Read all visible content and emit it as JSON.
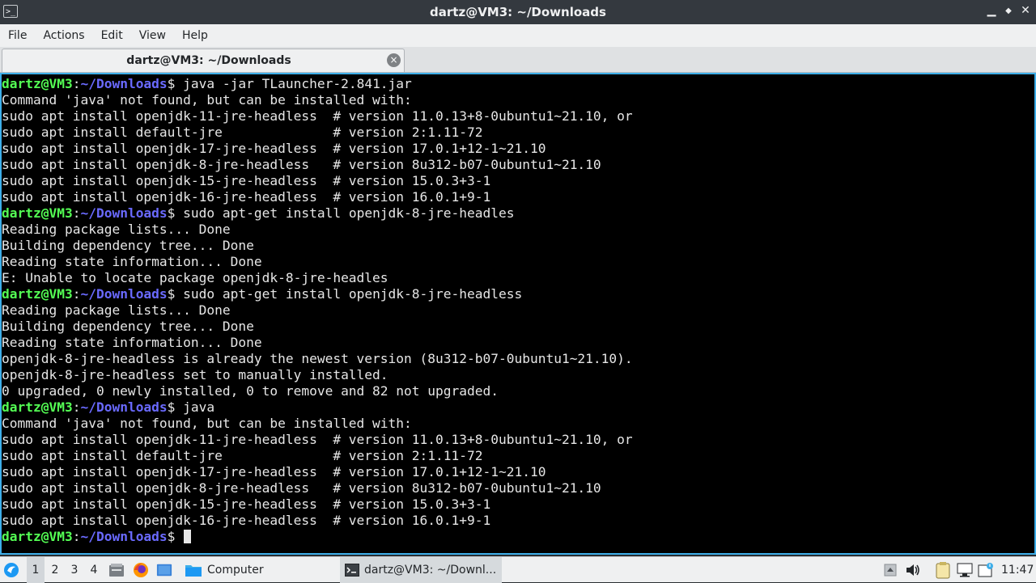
{
  "window": {
    "title": "dartz@VM3: ~/Downloads",
    "controls": {
      "minimize": "▁",
      "maximize": "◆",
      "close": "✕"
    }
  },
  "menu": [
    "File",
    "Actions",
    "Edit",
    "View",
    "Help"
  ],
  "tab": {
    "label": "dartz@VM3: ~/Downloads",
    "close": "×"
  },
  "terminal": {
    "lines": [
      {
        "user": "dartz@VM3",
        "path": "~/Downloads",
        "cmd": " java -jar TLauncher-2.841.jar"
      },
      {
        "text": "Command 'java' not found, but can be installed with:"
      },
      {
        "text": "sudo apt install openjdk-11-jre-headless  # version 11.0.13+8-0ubuntu1~21.10, or"
      },
      {
        "text": "sudo apt install default-jre              # version 2:1.11-72"
      },
      {
        "text": "sudo apt install openjdk-17-jre-headless  # version 17.0.1+12-1~21.10"
      },
      {
        "text": "sudo apt install openjdk-8-jre-headless   # version 8u312-b07-0ubuntu1~21.10"
      },
      {
        "text": "sudo apt install openjdk-15-jre-headless  # version 15.0.3+3-1"
      },
      {
        "text": "sudo apt install openjdk-16-jre-headless  # version 16.0.1+9-1"
      },
      {
        "user": "dartz@VM3",
        "path": "~/Downloads",
        "cmd": " sudo apt-get install openjdk-8-jre-headles"
      },
      {
        "text": "Reading package lists... Done"
      },
      {
        "text": "Building dependency tree... Done"
      },
      {
        "text": "Reading state information... Done"
      },
      {
        "text": "E: Unable to locate package openjdk-8-jre-headles"
      },
      {
        "user": "dartz@VM3",
        "path": "~/Downloads",
        "cmd": " sudo apt-get install openjdk-8-jre-headless"
      },
      {
        "text": "Reading package lists... Done"
      },
      {
        "text": "Building dependency tree... Done"
      },
      {
        "text": "Reading state information... Done"
      },
      {
        "text": "openjdk-8-jre-headless is already the newest version (8u312-b07-0ubuntu1~21.10)."
      },
      {
        "text": "openjdk-8-jre-headless set to manually installed."
      },
      {
        "text": "0 upgraded, 0 newly installed, 0 to remove and 82 not upgraded."
      },
      {
        "user": "dartz@VM3",
        "path": "~/Downloads",
        "cmd": " java"
      },
      {
        "text": "Command 'java' not found, but can be installed with:"
      },
      {
        "text": "sudo apt install openjdk-11-jre-headless  # version 11.0.13+8-0ubuntu1~21.10, or"
      },
      {
        "text": "sudo apt install default-jre              # version 2:1.11-72"
      },
      {
        "text": "sudo apt install openjdk-17-jre-headless  # version 17.0.1+12-1~21.10"
      },
      {
        "text": "sudo apt install openjdk-8-jre-headless   # version 8u312-b07-0ubuntu1~21.10"
      },
      {
        "text": "sudo apt install openjdk-15-jre-headless  # version 15.0.3+3-1"
      },
      {
        "text": "sudo apt install openjdk-16-jre-headless  # version 16.0.1+9-1"
      },
      {
        "user": "dartz@VM3",
        "path": "~/Downloads",
        "cmd": " ",
        "cursor": true
      }
    ]
  },
  "taskbar": {
    "workspaces": [
      "1",
      "2",
      "3",
      "4"
    ],
    "active_workspace": "1",
    "launchers": [
      "start-menu-icon",
      "file-manager-icon",
      "firefox-icon",
      "terminal-launcher-icon"
    ],
    "tasks": [
      {
        "label": "Computer",
        "icon": "folder-icon"
      },
      {
        "label": "dartz@VM3: ~/Downl...",
        "icon": "terminal-icon",
        "active": true
      }
    ],
    "tray": [
      "tray-up-icon",
      "volume-icon",
      "clipboard-icon",
      "network-icon",
      "update-icon"
    ],
    "clock": "11:47"
  },
  "colors": {
    "prompt_user": "#54ff54",
    "prompt_path": "#6a6aff",
    "focus_border": "#3daee9"
  }
}
